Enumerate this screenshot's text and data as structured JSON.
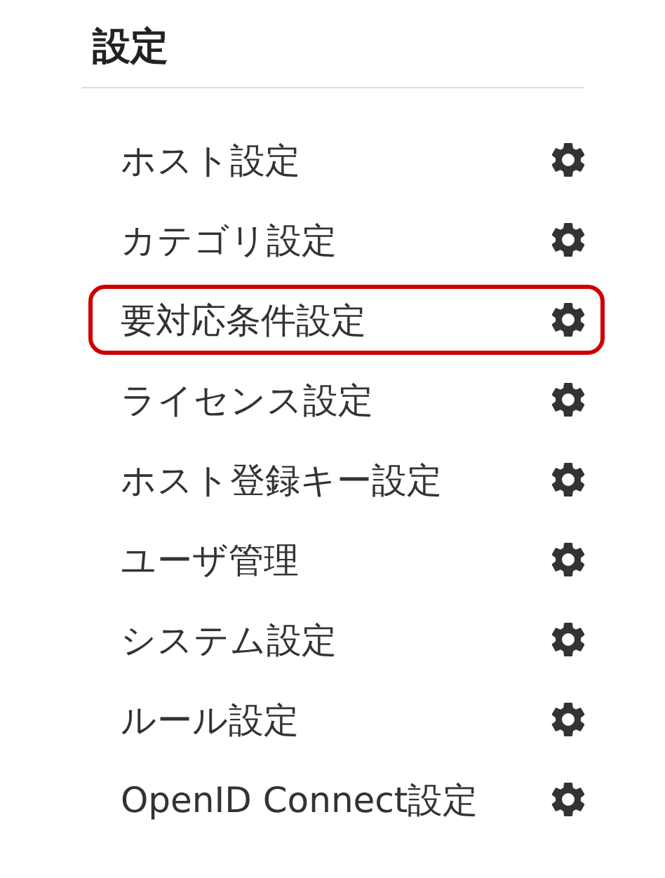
{
  "title": "設定",
  "items": [
    {
      "label": "ホスト設定",
      "highlighted": false
    },
    {
      "label": "カテゴリ設定",
      "highlighted": false
    },
    {
      "label": "要対応条件設定",
      "highlighted": true
    },
    {
      "label": "ライセンス設定",
      "highlighted": false
    },
    {
      "label": "ホスト登録キー設定",
      "highlighted": false
    },
    {
      "label": "ユーザ管理",
      "highlighted": false
    },
    {
      "label": "システム設定",
      "highlighted": false
    },
    {
      "label": "ルール設定",
      "highlighted": false
    },
    {
      "label": "OpenID Connect設定",
      "highlighted": false
    }
  ]
}
